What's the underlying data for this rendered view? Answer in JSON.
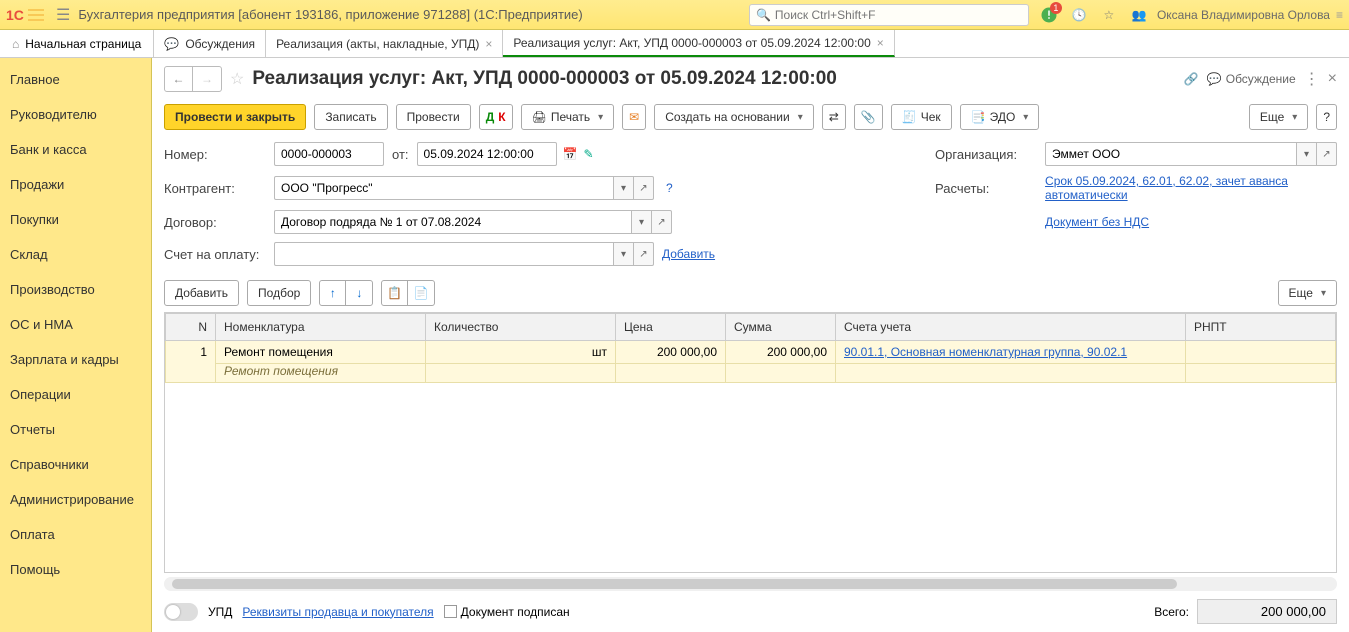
{
  "topbar": {
    "app_title": "Бухгалтерия предприятия [абонент 193186, приложение 971288]  (1С:Предприятие)",
    "search_placeholder": "Поиск Ctrl+Shift+F",
    "notification_count": "1",
    "username": "Оксана Владимировна Орлова"
  },
  "tabs": {
    "home": "Начальная страница",
    "t1": "Обсуждения",
    "t2": "Реализация (акты, накладные, УПД)",
    "t3": "Реализация услуг: Акт, УПД 0000-000003 от 05.09.2024 12:00:00"
  },
  "nav": {
    "items": [
      "Главное",
      "Руководителю",
      "Банк и касса",
      "Продажи",
      "Покупки",
      "Склад",
      "Производство",
      "ОС и НМА",
      "Зарплата и кадры",
      "Операции",
      "Отчеты",
      "Справочники",
      "Администрирование",
      "Оплата",
      "Помощь"
    ]
  },
  "doc": {
    "title": "Реализация услуг: Акт, УПД 0000-000003 от 05.09.2024 12:00:00",
    "discuss": "Обсуждение"
  },
  "toolbar": {
    "post_close": "Провести и закрыть",
    "save": "Записать",
    "post": "Провести",
    "print": "Печать",
    "create_based": "Создать на основании",
    "check": "Чек",
    "edo": "ЭДО",
    "more": "Еще"
  },
  "form": {
    "num_label": "Номер:",
    "num_value": "0000-000003",
    "from_label": "от:",
    "date_value": "05.09.2024 12:00:00",
    "contragent_label": "Контрагент:",
    "contragent_value": "ООО \"Прогресс\"",
    "contract_label": "Договор:",
    "contract_value": "Договор подряда № 1 от 07.08.2024",
    "invoice_label": "Счет на оплату:",
    "invoice_value": "",
    "add_link": "Добавить",
    "org_label": "Организация:",
    "org_value": "Эммет ООО",
    "calc_label": "Расчеты:",
    "calc_link": "Срок 05.09.2024, 62.01, 62.02, зачет аванса автоматически",
    "nds_link": "Документ без НДС"
  },
  "tbltbar": {
    "add": "Добавить",
    "pick": "Подбор",
    "more": "Еще"
  },
  "table": {
    "cols": [
      "N",
      "Номенклатура",
      "Количество",
      "Цена",
      "Сумма",
      "Счета учета",
      "РНПТ"
    ],
    "row": {
      "n": "1",
      "nomen": "Ремонт помещения",
      "qty_unit": "шт",
      "price": "200 000,00",
      "sum": "200 000,00",
      "accounts": "90.01.1, Основная номенклатурная группа, 90.02.1"
    },
    "subnomen": "Ремонт помещения"
  },
  "footer": {
    "upd": "УПД",
    "req_link": "Реквизиты продавца и покупателя",
    "signed": "Документ подписан",
    "total_label": "Всего:",
    "total_value": "200 000,00"
  }
}
